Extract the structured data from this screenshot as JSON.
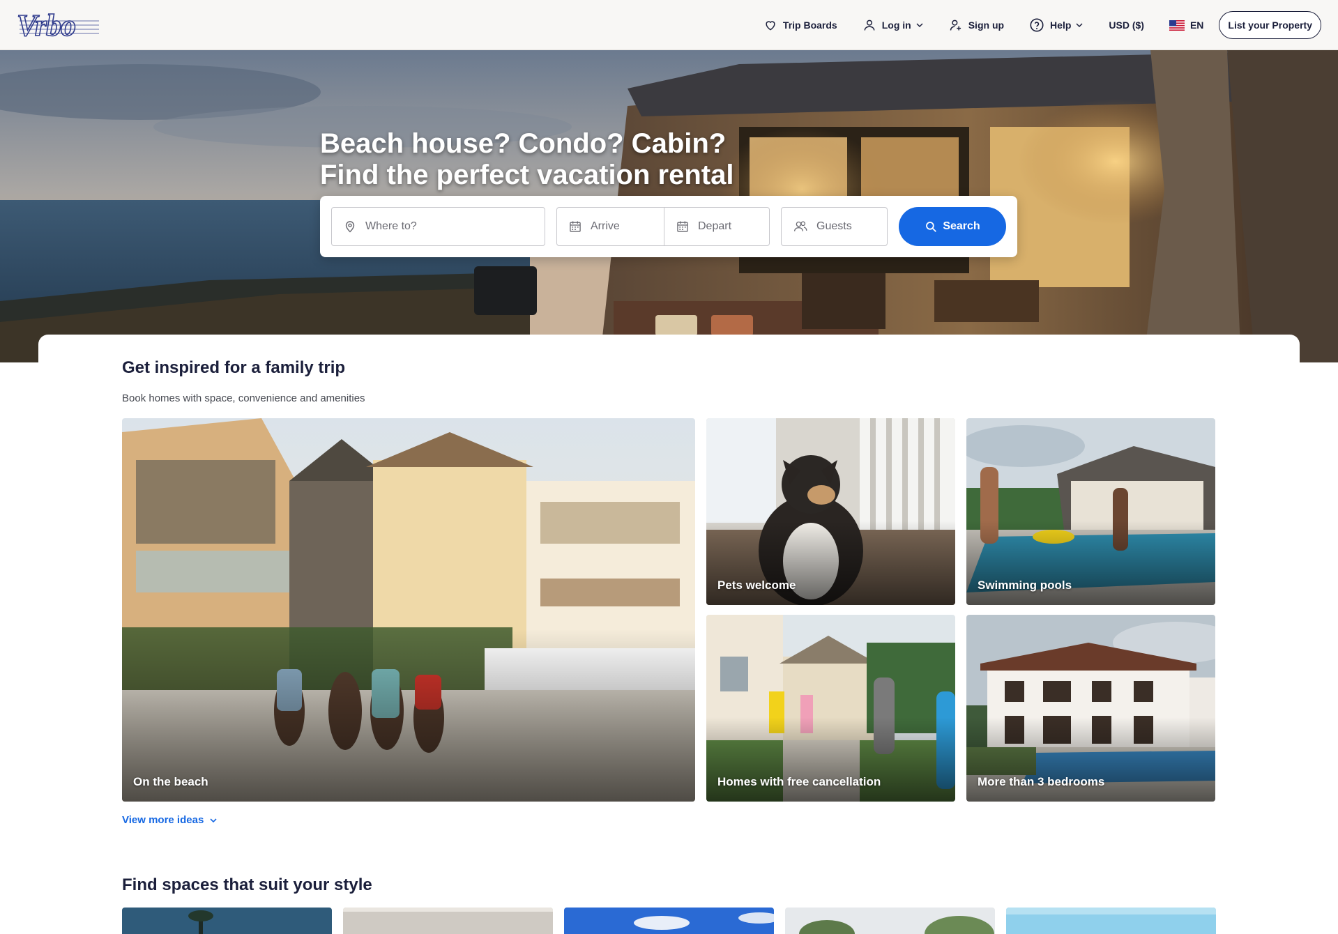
{
  "brand": {
    "logo_text": "Vrbo",
    "accent": "#1668e3",
    "ink": "#1b1f3b"
  },
  "header": {
    "nav": [
      {
        "label": "Trip Boards",
        "icon": "heart-icon"
      },
      {
        "label": "Log in",
        "icon": "user-icon",
        "has_dropdown": true
      },
      {
        "label": "Sign up",
        "icon": "add-user-icon"
      },
      {
        "label": "Help",
        "icon": "help-circle-icon",
        "has_dropdown": true
      },
      {
        "label": "USD ($)"
      },
      {
        "label": "EN",
        "icon": "us-flag-icon"
      }
    ],
    "list_property_label": "List your Property"
  },
  "hero": {
    "title_line1": "Beach house? Condo? Cabin?",
    "title_line2": "Find the perfect vacation rental"
  },
  "search": {
    "where_placeholder": "Where to?",
    "arrive_placeholder": "Arrive",
    "depart_placeholder": "Depart",
    "guests_placeholder": "Guests",
    "button_label": "Search"
  },
  "inspired": {
    "title": "Get inspired for a family trip",
    "subtitle": "Book homes with space, convenience and amenities",
    "tiles": [
      {
        "label": "On the beach"
      },
      {
        "label": "Pets welcome"
      },
      {
        "label": "Swimming pools"
      },
      {
        "label": "Homes with free cancellation"
      },
      {
        "label": "More than 3 bedrooms"
      }
    ],
    "view_more_label": "View more ideas"
  },
  "spaces": {
    "title": "Find spaces that suit your style"
  }
}
